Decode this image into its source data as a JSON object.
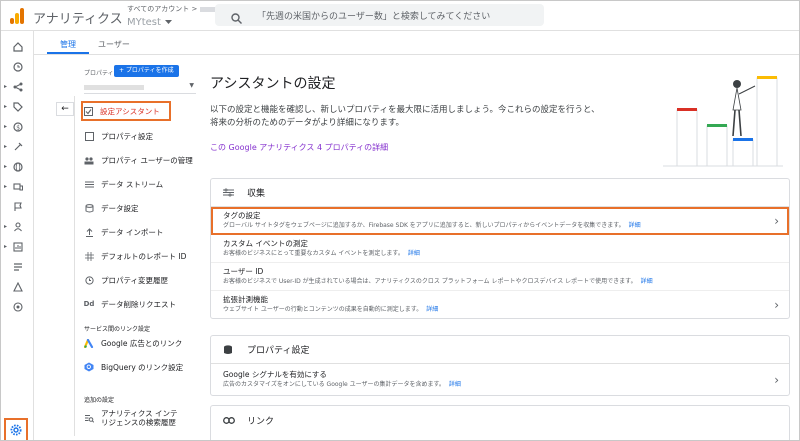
{
  "app": {
    "title": "アナリティクス",
    "breadcrumb": "すべてのアカウント >",
    "property_name": "MYtest"
  },
  "search": {
    "placeholder": "「先週の米国からのユーザー数」と検索してみてください"
  },
  "colors": {
    "accent": "#1a73e8",
    "highlight": "#e8702a",
    "link_purple": "#8430ce"
  },
  "rail": {
    "icons": [
      "home-icon",
      "clock-icon",
      "flow-icon",
      "tag-icon",
      "dollar-icon",
      "sparkle-icon",
      "globe-icon",
      "devices-icon",
      "flag-icon",
      "person-icon",
      "report-icon",
      "list-icon",
      "pyramid-icon",
      "target-icon",
      "gear-icon"
    ]
  },
  "tabs": [
    {
      "label": "管理"
    },
    {
      "label": "ユーザー"
    }
  ],
  "nav": {
    "property_label": "プロパティ",
    "create_property": "+ プロパティを作成",
    "items": [
      {
        "label": "設定アシスタント",
        "icon": "checkbox-icon"
      },
      {
        "label": "プロパティ設定",
        "icon": "square-icon"
      },
      {
        "label": "プロパティ ユーザーの管理",
        "icon": "people-icon"
      },
      {
        "label": "データ ストリーム",
        "icon": "streams-icon"
      },
      {
        "label": "データ設定",
        "icon": "database-icon"
      },
      {
        "label": "データ インポート",
        "icon": "upload-icon"
      },
      {
        "label": "デフォルトのレポート ID",
        "icon": "id-icon"
      },
      {
        "label": "プロパティ変更履歴",
        "icon": "history-icon"
      },
      {
        "label": "データ削除リクエスト",
        "icon": "dd-icon"
      }
    ],
    "service_links_header": "サービス間のリンク設定",
    "service_links": [
      {
        "label": "Google 広告とのリンク",
        "icon": "google-ads-icon"
      },
      {
        "label": "BigQuery のリンク設定",
        "icon": "bigquery-icon"
      }
    ],
    "extra_header": "追加の設定",
    "extra": [
      {
        "label": "アナリティクス インテリジェンスの検索履歴",
        "icon": "search-history-icon"
      }
    ]
  },
  "main": {
    "title": "アシスタントの設定",
    "description": "以下の設定と機能を確認し、新しいプロパティを最大限に活用しましょう。今これらの設定を行うと、将来の分析のためのデータがより詳細になります。",
    "ga4_link": "この Google アナリティクス 4 プロパティの詳細",
    "collect": {
      "header": "収集",
      "rows": [
        {
          "title": "タグの設定",
          "sub": "グローバル サイトタグをウェブページに追加するか、Firebase SDK をアプリに追加すると、新しいプロパティからイベントデータを収集できます。",
          "link": "詳細",
          "chevron": true
        },
        {
          "title": "カスタム イベントの測定",
          "sub": "お客様のビジネスにとって重要なカスタム イベントを測定します。",
          "link": "詳細",
          "chevron": false
        },
        {
          "title": "ユーザー ID",
          "sub": "お客様のビジネスで User-ID が生成されている場合は、アナリティクスのクロス プラットフォーム レポートやクロスデバイス レポートで使用できます。",
          "link": "詳細",
          "chevron": false
        },
        {
          "title": "拡張計測機能",
          "sub": "ウェブサイト ユーザーの行動とコンテンツの成果を自動的に測定します。",
          "link": "詳細",
          "chevron": true
        }
      ]
    },
    "property_settings": {
      "header": "プロパティ設定",
      "rows": [
        {
          "title": "Google シグナルを有効にする",
          "sub": "広告のカスタマイズをオンにしている Google ユーザーの集計データを含めます。",
          "link": "詳細",
          "chevron": true
        }
      ]
    },
    "links": {
      "header": "リンク"
    }
  }
}
